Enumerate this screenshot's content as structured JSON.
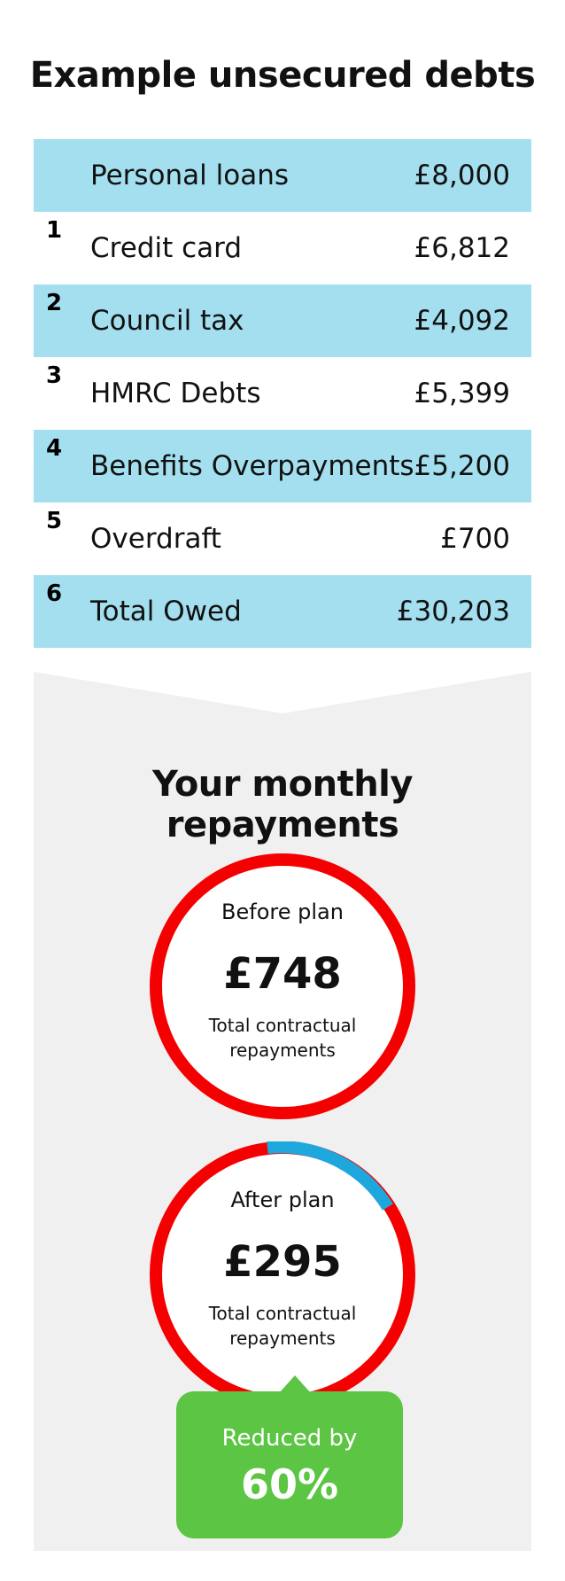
{
  "title": "Example unsecured debts",
  "debts": [
    {
      "num": "",
      "name": "Personal loans",
      "amount": "£8,000"
    },
    {
      "num": "1",
      "name": "Credit card",
      "amount": "£6,812"
    },
    {
      "num": "2",
      "name": "Council tax",
      "amount": "£4,092"
    },
    {
      "num": "3",
      "name": "HMRC Debts",
      "amount": "£5,399"
    },
    {
      "num": "4",
      "name": "Benefits Overpayments",
      "amount": "£5,200"
    },
    {
      "num": "5",
      "name": "Overdraft",
      "amount": "£700"
    },
    {
      "num": "6",
      "name": "Total Owed",
      "amount": "£30,203"
    }
  ],
  "repayments": {
    "title": "Your monthly repayments",
    "before": {
      "label": "Before plan",
      "amount": "£748",
      "sub1": "Total contractual",
      "sub2": "repayments"
    },
    "after": {
      "label": "After plan",
      "amount": "£295",
      "sub1": "Total contractual",
      "sub2": "repayments"
    },
    "reduction": {
      "label": "Reduced by",
      "value": "60%"
    }
  },
  "colors": {
    "row_shade": "#a3dfef",
    "ring_red": "#f40000",
    "ring_blue": "#1ea7dd",
    "badge_green": "#5cc543",
    "panel_grey": "#f0f0f0"
  }
}
